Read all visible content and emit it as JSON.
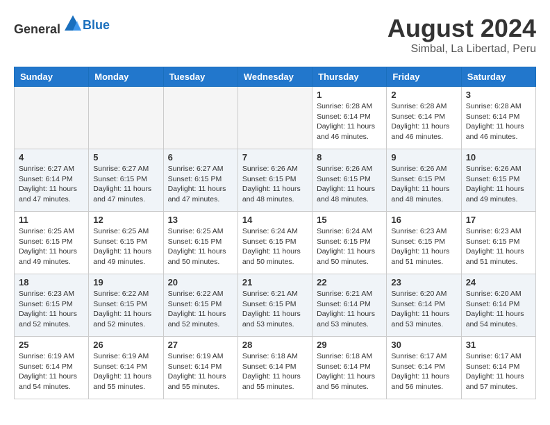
{
  "header": {
    "logo_general": "General",
    "logo_blue": "Blue",
    "month_title": "August 2024",
    "subtitle": "Simbal, La Libertad, Peru"
  },
  "days_of_week": [
    "Sunday",
    "Monday",
    "Tuesday",
    "Wednesday",
    "Thursday",
    "Friday",
    "Saturday"
  ],
  "weeks": [
    [
      {
        "day": "",
        "info": ""
      },
      {
        "day": "",
        "info": ""
      },
      {
        "day": "",
        "info": ""
      },
      {
        "day": "",
        "info": ""
      },
      {
        "day": "1",
        "info": "Sunrise: 6:28 AM\nSunset: 6:14 PM\nDaylight: 11 hours\nand 46 minutes."
      },
      {
        "day": "2",
        "info": "Sunrise: 6:28 AM\nSunset: 6:14 PM\nDaylight: 11 hours\nand 46 minutes."
      },
      {
        "day": "3",
        "info": "Sunrise: 6:28 AM\nSunset: 6:14 PM\nDaylight: 11 hours\nand 46 minutes."
      }
    ],
    [
      {
        "day": "4",
        "info": "Sunrise: 6:27 AM\nSunset: 6:14 PM\nDaylight: 11 hours\nand 47 minutes."
      },
      {
        "day": "5",
        "info": "Sunrise: 6:27 AM\nSunset: 6:15 PM\nDaylight: 11 hours\nand 47 minutes."
      },
      {
        "day": "6",
        "info": "Sunrise: 6:27 AM\nSunset: 6:15 PM\nDaylight: 11 hours\nand 47 minutes."
      },
      {
        "day": "7",
        "info": "Sunrise: 6:26 AM\nSunset: 6:15 PM\nDaylight: 11 hours\nand 48 minutes."
      },
      {
        "day": "8",
        "info": "Sunrise: 6:26 AM\nSunset: 6:15 PM\nDaylight: 11 hours\nand 48 minutes."
      },
      {
        "day": "9",
        "info": "Sunrise: 6:26 AM\nSunset: 6:15 PM\nDaylight: 11 hours\nand 48 minutes."
      },
      {
        "day": "10",
        "info": "Sunrise: 6:26 AM\nSunset: 6:15 PM\nDaylight: 11 hours\nand 49 minutes."
      }
    ],
    [
      {
        "day": "11",
        "info": "Sunrise: 6:25 AM\nSunset: 6:15 PM\nDaylight: 11 hours\nand 49 minutes."
      },
      {
        "day": "12",
        "info": "Sunrise: 6:25 AM\nSunset: 6:15 PM\nDaylight: 11 hours\nand 49 minutes."
      },
      {
        "day": "13",
        "info": "Sunrise: 6:25 AM\nSunset: 6:15 PM\nDaylight: 11 hours\nand 50 minutes."
      },
      {
        "day": "14",
        "info": "Sunrise: 6:24 AM\nSunset: 6:15 PM\nDaylight: 11 hours\nand 50 minutes."
      },
      {
        "day": "15",
        "info": "Sunrise: 6:24 AM\nSunset: 6:15 PM\nDaylight: 11 hours\nand 50 minutes."
      },
      {
        "day": "16",
        "info": "Sunrise: 6:23 AM\nSunset: 6:15 PM\nDaylight: 11 hours\nand 51 minutes."
      },
      {
        "day": "17",
        "info": "Sunrise: 6:23 AM\nSunset: 6:15 PM\nDaylight: 11 hours\nand 51 minutes."
      }
    ],
    [
      {
        "day": "18",
        "info": "Sunrise: 6:23 AM\nSunset: 6:15 PM\nDaylight: 11 hours\nand 52 minutes."
      },
      {
        "day": "19",
        "info": "Sunrise: 6:22 AM\nSunset: 6:15 PM\nDaylight: 11 hours\nand 52 minutes."
      },
      {
        "day": "20",
        "info": "Sunrise: 6:22 AM\nSunset: 6:15 PM\nDaylight: 11 hours\nand 52 minutes."
      },
      {
        "day": "21",
        "info": "Sunrise: 6:21 AM\nSunset: 6:15 PM\nDaylight: 11 hours\nand 53 minutes."
      },
      {
        "day": "22",
        "info": "Sunrise: 6:21 AM\nSunset: 6:14 PM\nDaylight: 11 hours\nand 53 minutes."
      },
      {
        "day": "23",
        "info": "Sunrise: 6:20 AM\nSunset: 6:14 PM\nDaylight: 11 hours\nand 53 minutes."
      },
      {
        "day": "24",
        "info": "Sunrise: 6:20 AM\nSunset: 6:14 PM\nDaylight: 11 hours\nand 54 minutes."
      }
    ],
    [
      {
        "day": "25",
        "info": "Sunrise: 6:19 AM\nSunset: 6:14 PM\nDaylight: 11 hours\nand 54 minutes."
      },
      {
        "day": "26",
        "info": "Sunrise: 6:19 AM\nSunset: 6:14 PM\nDaylight: 11 hours\nand 55 minutes."
      },
      {
        "day": "27",
        "info": "Sunrise: 6:19 AM\nSunset: 6:14 PM\nDaylight: 11 hours\nand 55 minutes."
      },
      {
        "day": "28",
        "info": "Sunrise: 6:18 AM\nSunset: 6:14 PM\nDaylight: 11 hours\nand 55 minutes."
      },
      {
        "day": "29",
        "info": "Sunrise: 6:18 AM\nSunset: 6:14 PM\nDaylight: 11 hours\nand 56 minutes."
      },
      {
        "day": "30",
        "info": "Sunrise: 6:17 AM\nSunset: 6:14 PM\nDaylight: 11 hours\nand 56 minutes."
      },
      {
        "day": "31",
        "info": "Sunrise: 6:17 AM\nSunset: 6:14 PM\nDaylight: 11 hours\nand 57 minutes."
      }
    ]
  ],
  "colors": {
    "header_bg": "#2277cc",
    "header_text": "#ffffff",
    "alt_row_bg": "#f0f4f8",
    "empty_bg": "#f5f5f5",
    "logo_blue": "#1a6fbd"
  }
}
